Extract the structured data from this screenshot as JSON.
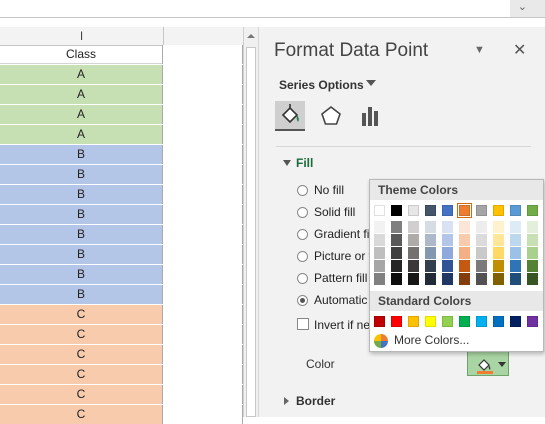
{
  "sheet": {
    "column_header": "I",
    "header_cell": "Class",
    "rows": [
      {
        "value": "A",
        "color": "#c6e0b4"
      },
      {
        "value": "A",
        "color": "#c6e0b4"
      },
      {
        "value": "A",
        "color": "#c6e0b4"
      },
      {
        "value": "A",
        "color": "#c6e0b4"
      },
      {
        "value": "B",
        "color": "#b4c6e7"
      },
      {
        "value": "B",
        "color": "#b4c6e7"
      },
      {
        "value": "B",
        "color": "#b4c6e7"
      },
      {
        "value": "B",
        "color": "#b4c6e7"
      },
      {
        "value": "B",
        "color": "#b4c6e7"
      },
      {
        "value": "B",
        "color": "#b4c6e7"
      },
      {
        "value": "B",
        "color": "#b4c6e7"
      },
      {
        "value": "B",
        "color": "#b4c6e7"
      },
      {
        "value": "C",
        "color": "#f8cbad"
      },
      {
        "value": "C",
        "color": "#f8cbad"
      },
      {
        "value": "C",
        "color": "#f8cbad"
      },
      {
        "value": "C",
        "color": "#f8cbad"
      },
      {
        "value": "C",
        "color": "#f8cbad"
      },
      {
        "value": "C",
        "color": "#f8cbad"
      }
    ]
  },
  "pane": {
    "title": "Format Data Point",
    "series_options": "Series Options",
    "tabs": [
      "fill-line",
      "effects",
      "series-options"
    ],
    "fill_section": "Fill",
    "options": [
      {
        "label": "No fill",
        "selected": false
      },
      {
        "label": "Solid fill",
        "selected": false
      },
      {
        "label": "Gradient fi",
        "selected": false
      },
      {
        "label": "Picture or t",
        "selected": false
      },
      {
        "label": "Pattern fill",
        "selected": false
      },
      {
        "label": "Automatic",
        "selected": true
      }
    ],
    "invert_label": "Invert if ne",
    "color_label": "Color",
    "color_value": "#a9d4a3",
    "border_section": "Border"
  },
  "color_picker": {
    "theme_header": "Theme Colors",
    "standard_header": "Standard Colors",
    "more_colors": "More Colors...",
    "theme_top": [
      "#ffffff",
      "#000000",
      "#e7e6e6",
      "#44546a",
      "#4472c4",
      "#ed7d31",
      "#a5a5a5",
      "#ffc000",
      "#5b9bd5",
      "#70ad47"
    ],
    "selected_theme_index": 5,
    "theme_shades": [
      [
        "#f2f2f2",
        "#d9d9d9",
        "#bfbfbf",
        "#a6a6a6",
        "#808080"
      ],
      [
        "#7f7f7f",
        "#595959",
        "#404040",
        "#262626",
        "#0d0d0d"
      ],
      [
        "#d0cece",
        "#aeabab",
        "#757171",
        "#3a3838",
        "#171616"
      ],
      [
        "#d6dce4",
        "#adb9ca",
        "#8497b0",
        "#333f4f",
        "#222a35"
      ],
      [
        "#d9e1f2",
        "#b4c6e7",
        "#8ea9db",
        "#305496",
        "#203764"
      ],
      [
        "#fce4d6",
        "#f8cbad",
        "#f4b084",
        "#c65911",
        "#833c0b"
      ],
      [
        "#ededed",
        "#dbdbdb",
        "#c9c9c9",
        "#7b7b7b",
        "#525252"
      ],
      [
        "#fff2cc",
        "#ffe699",
        "#ffd966",
        "#bf8f00",
        "#806000"
      ],
      [
        "#ddebf7",
        "#bdd7ee",
        "#9bc2e6",
        "#2f75b5",
        "#1f4e78"
      ],
      [
        "#e2efda",
        "#c6e0b4",
        "#a9d08e",
        "#548235",
        "#375623"
      ]
    ],
    "standard": [
      "#c00000",
      "#ff0000",
      "#ffc000",
      "#ffff00",
      "#92d050",
      "#00b050",
      "#00b0f0",
      "#0070c0",
      "#002060",
      "#7030a0"
    ]
  }
}
